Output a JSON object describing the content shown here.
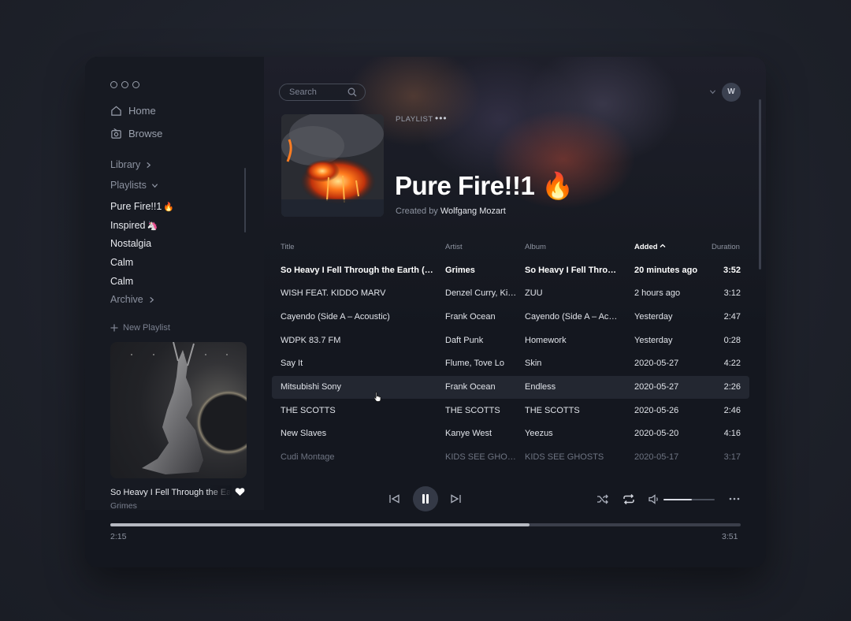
{
  "sidebar": {
    "nav": [
      {
        "label": "Home",
        "icon": "home-icon"
      },
      {
        "label": "Browse",
        "icon": "radio-icon"
      }
    ],
    "library_label": "Library",
    "playlists_label": "Playlists",
    "playlists": [
      {
        "label": "Pure Fire!!1",
        "emoji": "🔥"
      },
      {
        "label": "Inspired",
        "emoji": "🦄"
      },
      {
        "label": "Nostalgia",
        "emoji": ""
      },
      {
        "label": "Calm",
        "emoji": ""
      },
      {
        "label": "Calm",
        "emoji": ""
      }
    ],
    "archive_label": "Archive",
    "new_playlist_label": "New Playlist"
  },
  "header": {
    "search_placeholder": "Search",
    "user_initial": "W"
  },
  "playlist": {
    "type_label": "PLAYLIST",
    "more_label": "•••",
    "title": "Pure Fire!!1 🔥",
    "created_by_label": "Created by",
    "creator": "Wolfgang  Mozart"
  },
  "table": {
    "columns": {
      "title": "Title",
      "artist": "Artist",
      "album": "Album",
      "added": "Added",
      "duration": "Duration"
    },
    "sorted_by": "added",
    "rows": [
      {
        "title": "So Heavy I Fell Through the Earth (Algorithm Mix)",
        "artist": "Grimes",
        "album": "So Heavy I Fell Through the Earth",
        "added": "20 minutes ago",
        "duration": "3:52",
        "state": "playing"
      },
      {
        "title": "WISH FEAT. KIDDO MARV",
        "artist": "Denzel Curry, Kiddo Marv",
        "album": "ZUU",
        "added": "2 hours ago",
        "duration": "3:12",
        "state": "normal"
      },
      {
        "title": "Cayendo (Side A – Acoustic)",
        "artist": "Frank Ocean",
        "album": "Cayendo (Side A – Acoustic)",
        "added": "Yesterday",
        "duration": "2:47",
        "state": "normal"
      },
      {
        "title": "WDPK 83.7 FM",
        "artist": "Daft Punk",
        "album": "Homework",
        "added": "Yesterday",
        "duration": "0:28",
        "state": "normal"
      },
      {
        "title": "Say It",
        "artist": "Flume, Tove Lo",
        "album": "Skin",
        "added": "2020-05-27",
        "duration": "4:22",
        "state": "normal"
      },
      {
        "title": "Mitsubishi Sony",
        "artist": "Frank Ocean",
        "album": "Endless",
        "added": "2020-05-27",
        "duration": "2:26",
        "state": "hover"
      },
      {
        "title": "THE SCOTTS",
        "artist": "THE SCOTTS",
        "album": "THE SCOTTS",
        "added": "2020-05-26",
        "duration": "2:46",
        "state": "normal"
      },
      {
        "title": "New Slaves",
        "artist": "Kanye West",
        "album": "Yeezus",
        "added": "2020-05-20",
        "duration": "4:16",
        "state": "normal"
      },
      {
        "title": "Cudi Montage",
        "artist": "KIDS SEE GHOSTS",
        "album": "KIDS SEE GHOSTS",
        "added": "2020-05-17",
        "duration": "3:17",
        "state": "faded"
      }
    ]
  },
  "player": {
    "now_playing_title": "So Heavy I Fell Through the Earth",
    "now_playing_artist": "Grimes",
    "elapsed": "2:15",
    "total": "3:51",
    "progress_fraction": 0.665,
    "volume_fraction": 0.56,
    "liked": true
  },
  "colors": {
    "window_bg": "#14171f",
    "row_highlight": "#232731",
    "accent_fire": "#ff6a1a"
  }
}
